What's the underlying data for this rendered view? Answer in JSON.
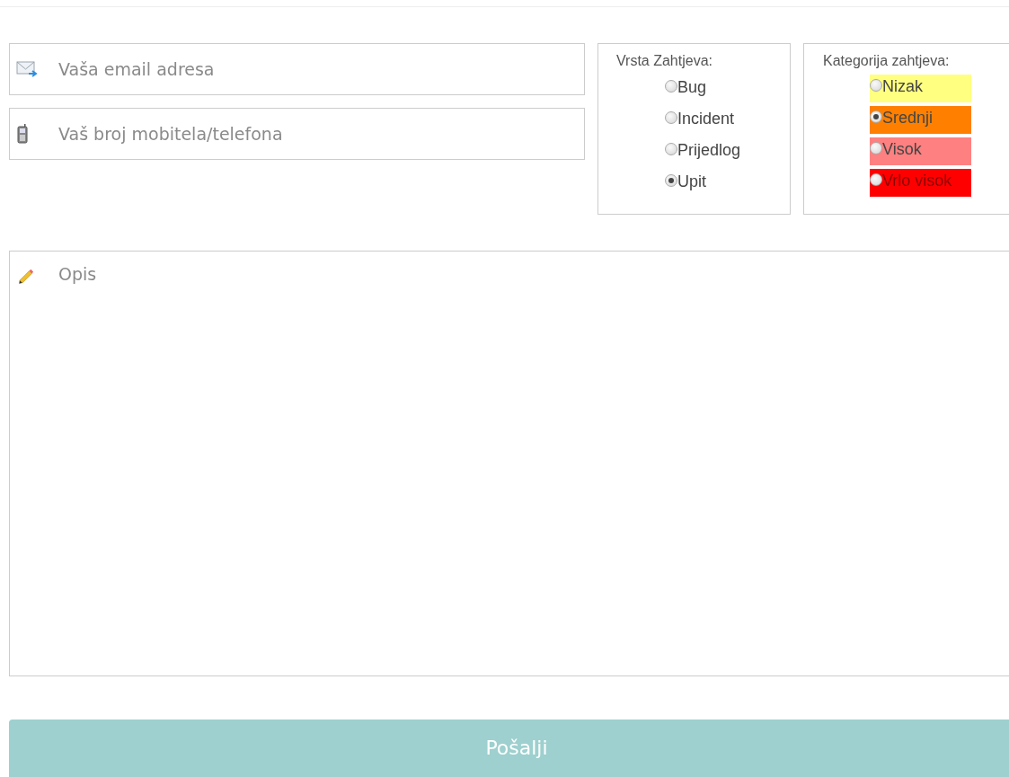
{
  "email_field": {
    "placeholder": "Vaša email adresa"
  },
  "phone_field": {
    "placeholder": "Vaš broj mobitela/telefona"
  },
  "request_type": {
    "title": "Vrsta Zahtjeva:",
    "options": [
      {
        "label": "Bug",
        "selected": false
      },
      {
        "label": "Incident",
        "selected": false
      },
      {
        "label": "Prijedlog",
        "selected": false
      },
      {
        "label": "Upit",
        "selected": true
      }
    ]
  },
  "request_category": {
    "title": "Kategorija zahtjeva:",
    "options": [
      {
        "label": "Nizak",
        "selected": false,
        "color": "#ffff80"
      },
      {
        "label": "Srednji",
        "selected": true,
        "color": "#ff8000"
      },
      {
        "label": "Visok",
        "selected": false,
        "color": "#ff8080"
      },
      {
        "label": "Vrlo visok",
        "selected": false,
        "color": "#ff0000"
      }
    ]
  },
  "description_field": {
    "placeholder": "Opis"
  },
  "submit_button": {
    "label": "Pošalji"
  }
}
